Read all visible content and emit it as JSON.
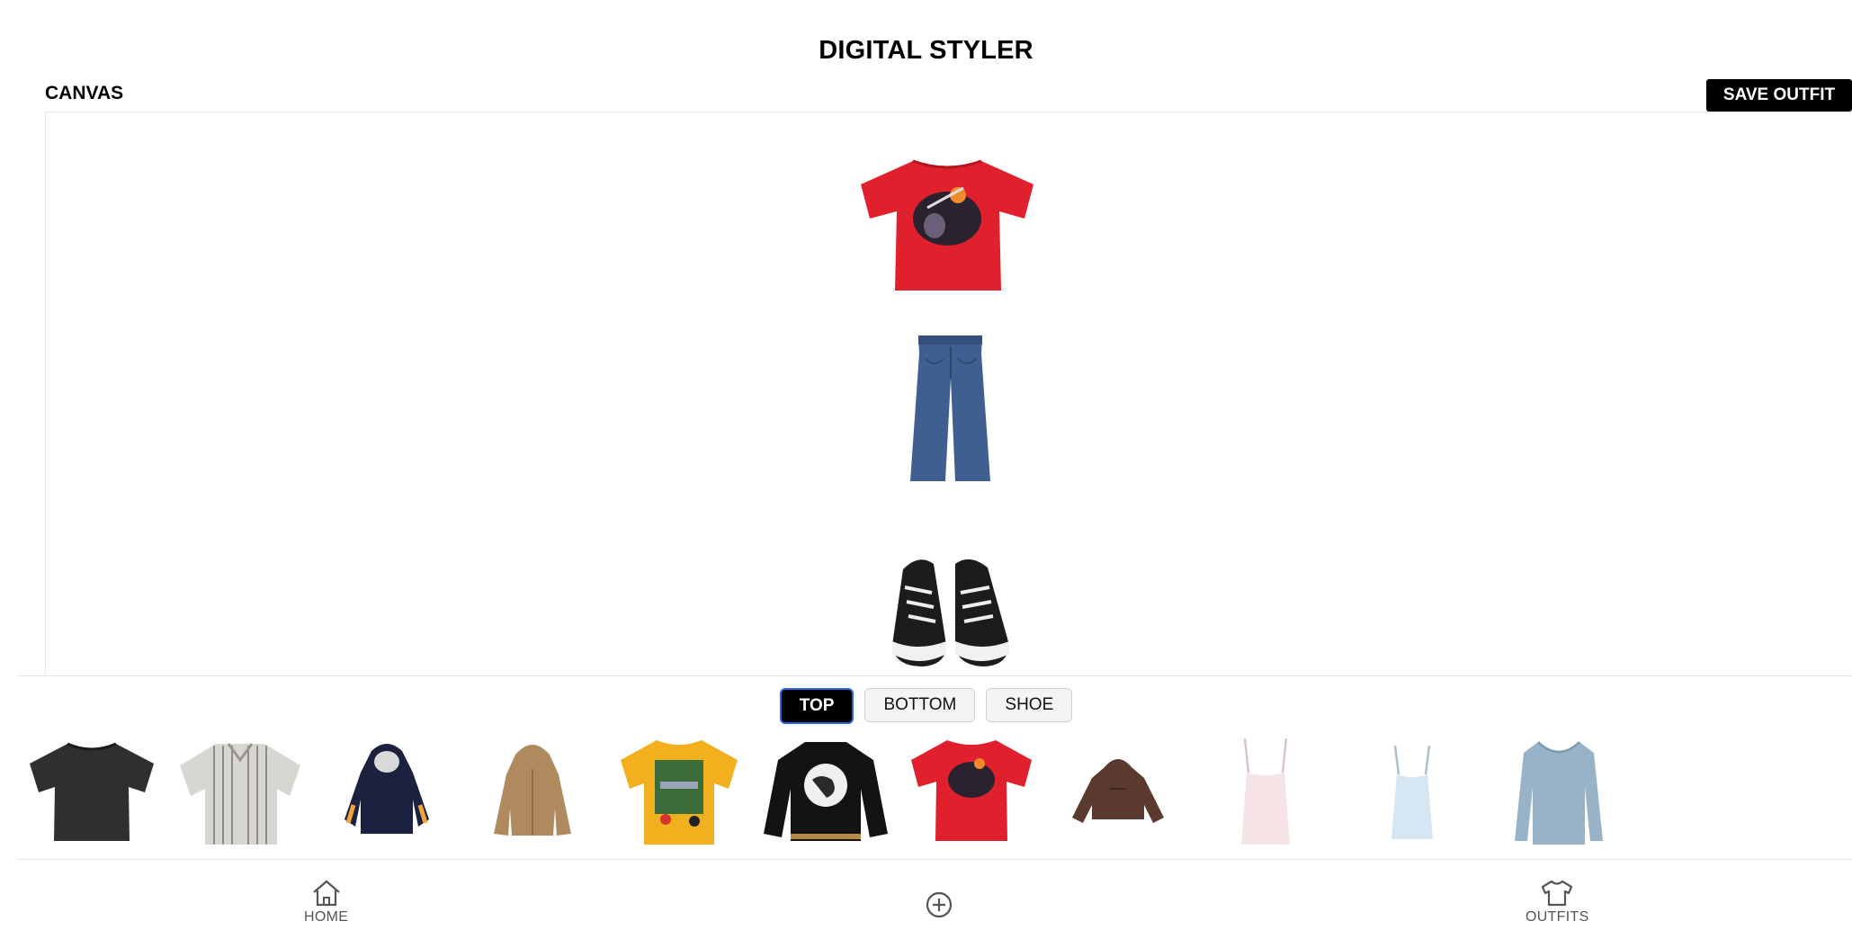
{
  "header": {
    "title": "DIGITAL STYLER"
  },
  "canvas": {
    "label": "CANVAS",
    "save_label": "SAVE OUTFIT"
  },
  "category_tabs": [
    {
      "label": "TOP",
      "active": true
    },
    {
      "label": "BOTTOM",
      "active": false
    },
    {
      "label": "SHOE",
      "active": false
    }
  ],
  "canvas_items": [
    "red-graphic-tee",
    "blue-wide-leg-jeans",
    "black-high-top-sneakers"
  ],
  "closet_items": [
    "black-tee",
    "striped-shirt",
    "navy-graphic-hoodie",
    "tan-zip-hoodie",
    "yellow-sardine-graphic-tee",
    "black-varsity-jacket",
    "red-graphic-tee",
    "brown-cropped-hoodie",
    "pink-cami",
    "light-blue-cami",
    "blue-long-sleeve-top"
  ],
  "bottom_nav": [
    {
      "label": "HOME",
      "icon": "home-icon"
    },
    {
      "label": "",
      "icon": "add-circle-icon"
    },
    {
      "label": "OUTFITS",
      "icon": "shirt-icon"
    }
  ],
  "colors": {
    "primary": "#000000",
    "active_tab_border": "#2f66d8",
    "divider": "#e4e4e4"
  }
}
